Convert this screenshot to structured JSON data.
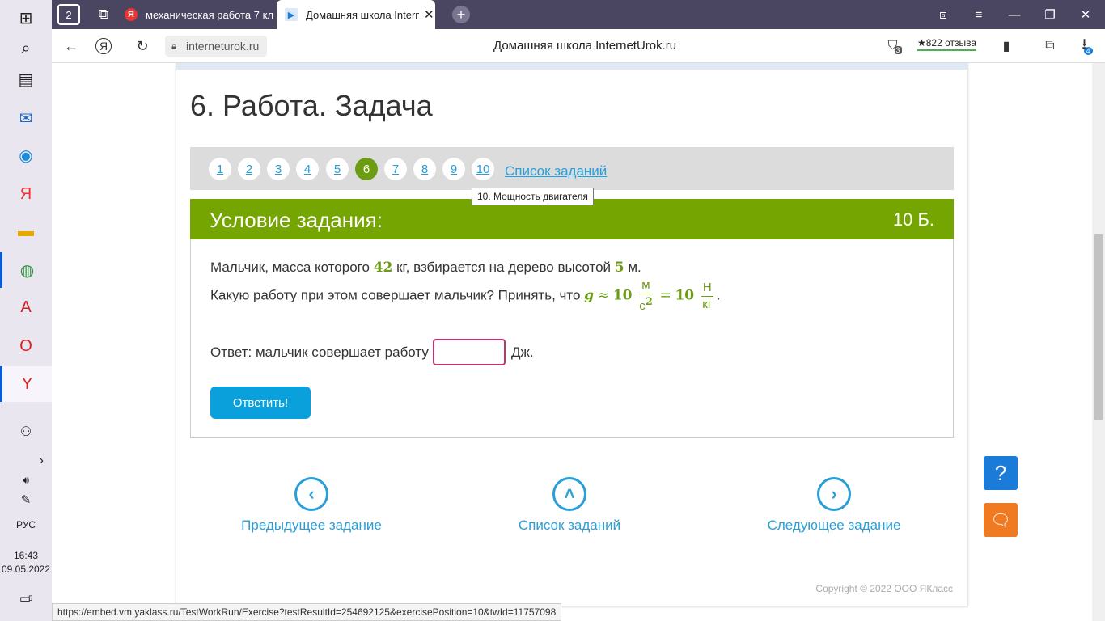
{
  "taskbar": {
    "lang": "РУС",
    "time": "16:43",
    "date": "09.05.2022",
    "badge": "5"
  },
  "browser": {
    "tab_count": "2",
    "tabs": [
      {
        "title": "механическая работа 7 кл",
        "favicon": "Я",
        "active": false
      },
      {
        "title": "Домашняя школа Intern",
        "favicon": "▶",
        "active": true
      }
    ],
    "url": "interneturok.ru",
    "page_title": "Домашняя школа InternetUrok.ru",
    "reviews": "★822 отзыва",
    "notif_count": "3",
    "downloads_count": "4",
    "status_url": "https://embed.vm.yaklass.ru/TestWorkRun/Exercise?testResultId=254692125&exercisePosition=10&twId=11757098"
  },
  "page": {
    "heading": "6. Работа. Задача",
    "task_numbers": [
      "1",
      "2",
      "3",
      "4",
      "5",
      "6",
      "7",
      "8",
      "9",
      "10"
    ],
    "current_task": "6",
    "task_list_link": "Список заданий",
    "tooltip": "10. Мощность двигателя",
    "condition_title": "Условие задания:",
    "points": "10 Б.",
    "line1_a": "Мальчик, масса которого",
    "mass": "42",
    "line1_b": "кг, взбирается на дерево высотой",
    "height": "5",
    "line1_c": "м.",
    "line2_a": "Какую работу при этом совершает мальчик? Принять, что",
    "g_symbol": "g",
    "approx": "≈",
    "g_value": "10",
    "unit1_num": "м",
    "unit1_den": "с",
    "unit1_den_exp": "2",
    "equals": "=",
    "g_value2": "10",
    "unit2_num": "Н",
    "unit2_den": "кг",
    "period": ".",
    "answer_label": "Ответ: мальчик совершает работу",
    "answer_value": "",
    "answer_unit": "Дж.",
    "submit": "Ответить!",
    "prev": "Предыдущее задание",
    "list": "Список заданий",
    "next": "Следующее задание",
    "copyright": "Copyright © 2022 ООО ЯКласс",
    "help": "?"
  },
  "colors": {
    "accent_green": "#75a500",
    "link_blue": "#2a9ed6",
    "button_blue": "#0aa0db",
    "input_border": "#c0336f"
  }
}
